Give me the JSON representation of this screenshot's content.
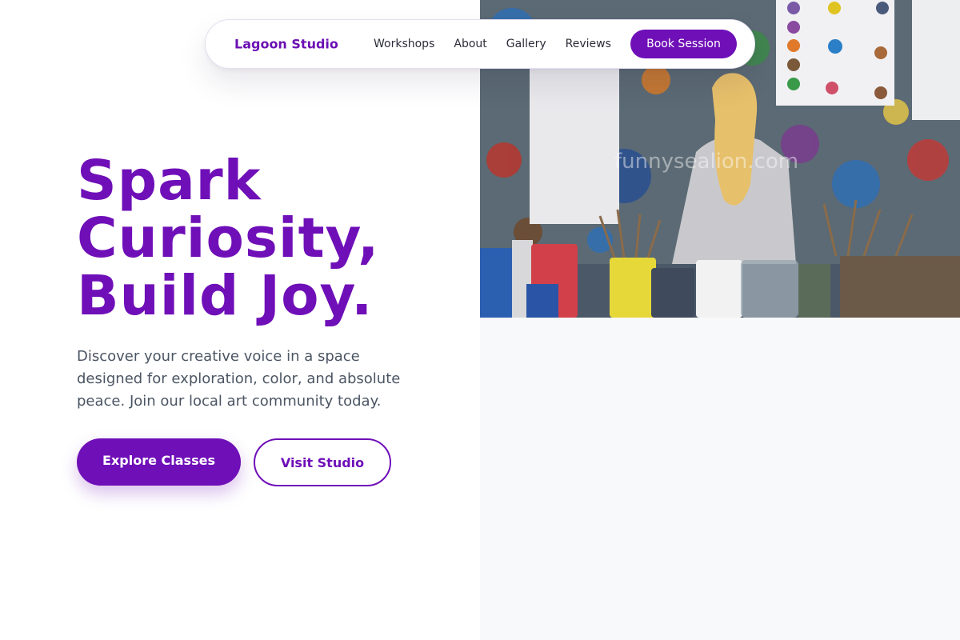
{
  "nav": {
    "brand": "Lagoon Studio",
    "links": [
      "Workshops",
      "About",
      "Gallery",
      "Reviews"
    ],
    "cta": "Book Session"
  },
  "hero": {
    "title_lines": [
      "Spark",
      "Curiosity,",
      "Build Joy."
    ],
    "subtitle": "Discover your creative voice in a space designed for exploration, color, and absolute peace. Join our local art community today.",
    "primary_button": "Explore Classes",
    "secondary_button": "Visit Studio",
    "image_watermark": "funnysealion.com"
  },
  "colors": {
    "accent": "#6f0fb8",
    "text_muted": "#4b5563",
    "panel_bg": "#f8f9fb"
  }
}
